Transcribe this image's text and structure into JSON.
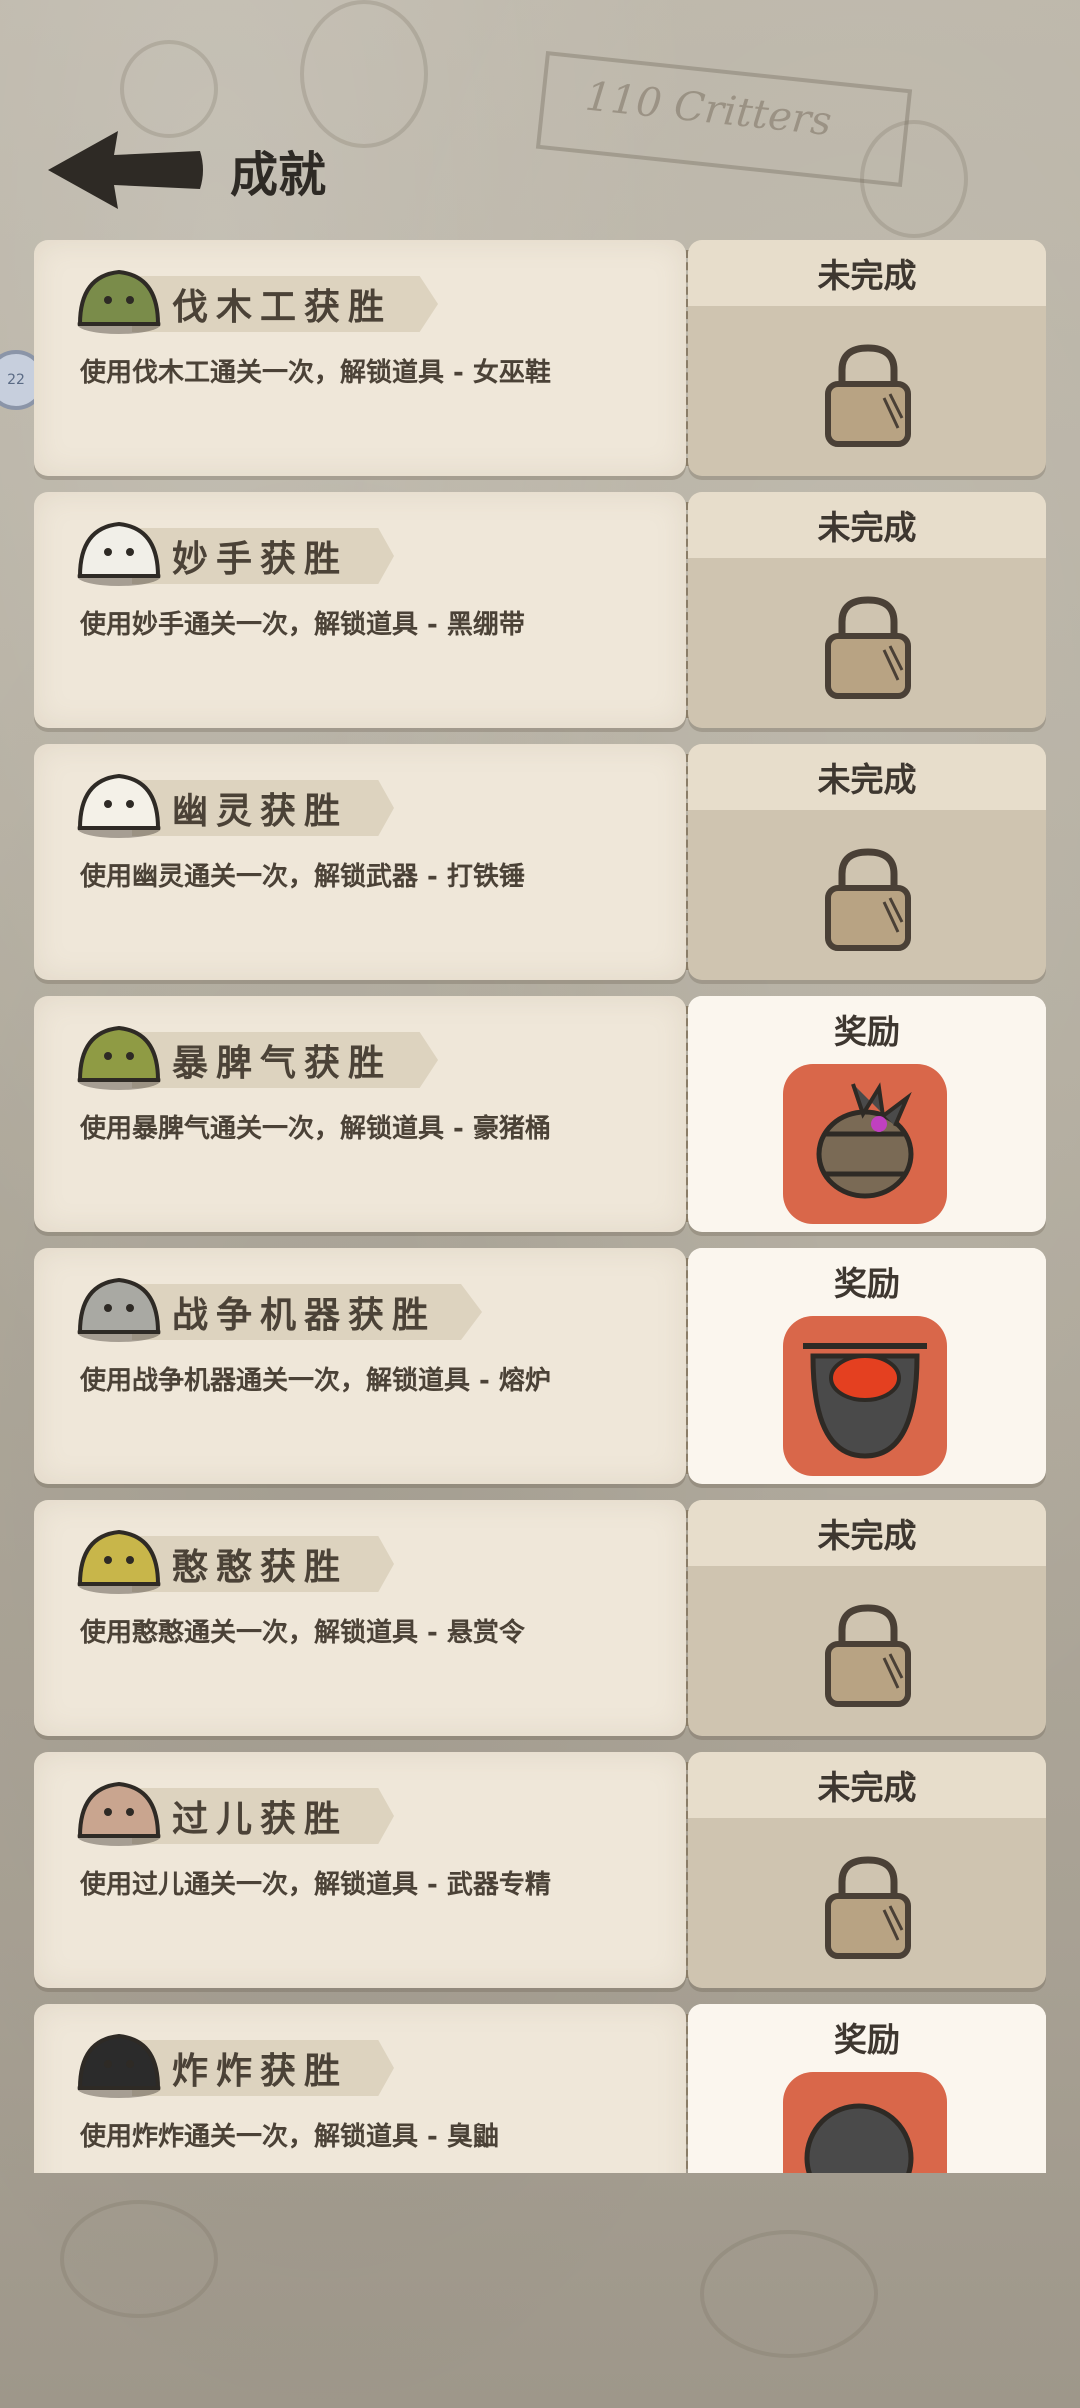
{
  "header": {
    "title": "成就"
  },
  "background": {
    "banner_text": "110 Critters",
    "side_badge": "22"
  },
  "cards": [
    {
      "title": "伐木工获胜",
      "desc": "使用伐木工通关一次，解锁道具 - 女巫鞋",
      "status": "未完成",
      "avatar": "lumberjack-avatar",
      "avatar_color": "#7a8c4a"
    },
    {
      "title": "妙手获胜",
      "desc": "使用妙手通关一次，解锁道具 - 黑绷带",
      "status": "未完成",
      "avatar": "thief-avatar",
      "avatar_color": "#f1efe8"
    },
    {
      "title": "幽灵获胜",
      "desc": "使用幽灵通关一次，解锁武器 - 打铁锤",
      "status": "未完成",
      "avatar": "ghost-avatar",
      "avatar_color": "#f4f1e8"
    },
    {
      "title": "暴脾气获胜",
      "desc": "使用暴脾气通关一次，解锁道具 - 豪猪桶",
      "status": "奖励",
      "avatar": "grumpy-avatar",
      "avatar_color": "#8f9b44",
      "reward": "porcupine-barrel"
    },
    {
      "title": "战争机器获胜",
      "desc": "使用战争机器通关一次，解锁道具 - 熔炉",
      "status": "奖励",
      "avatar": "war-machine-avatar",
      "avatar_color": "#a9a9a3",
      "reward": "furnace"
    },
    {
      "title": "憨憨获胜",
      "desc": "使用憨憨通关一次，解锁道具 - 悬赏令",
      "status": "未完成",
      "avatar": "dummy-avatar",
      "avatar_color": "#c8b64a"
    },
    {
      "title": "过儿获胜",
      "desc": "使用过儿通关一次，解锁道具 - 武器专精",
      "status": "未完成",
      "avatar": "guoer-avatar",
      "avatar_color": "#c9a58f"
    },
    {
      "title": "炸炸获胜",
      "desc": "使用炸炸通关一次，解锁道具 - 臭鼬",
      "status": "奖励",
      "avatar": "bomb-avatar",
      "avatar_color": "#2b2b2b",
      "reward": "skunk"
    }
  ]
}
